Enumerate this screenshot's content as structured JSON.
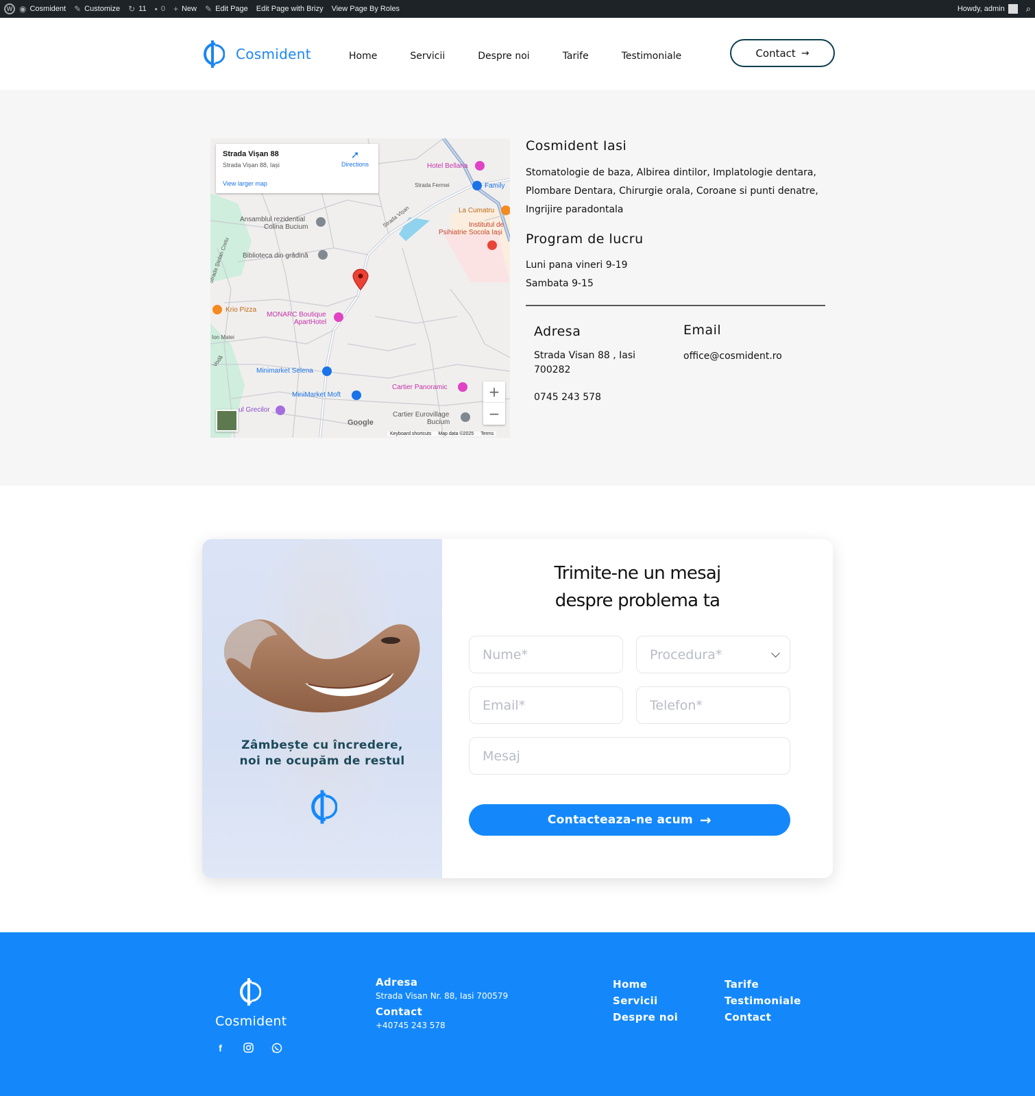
{
  "admin_bar": {
    "site": "Cosmident",
    "customize": "Customize",
    "updates": "11",
    "comments": "0",
    "new": "New",
    "edit_page": "Edit Page",
    "edit_brizy": "Edit Page with Brizy",
    "view_roles": "View Page By Roles",
    "howdy": "Howdy, admin"
  },
  "header": {
    "logo_text": "Cosmident",
    "nav": [
      "Home",
      "Servicii",
      "Despre noi",
      "Tarife",
      "Testimoniale"
    ],
    "contact_label": "Contact",
    "accent": "#1a86f2"
  },
  "map": {
    "place_title": "Strada Vișan 88",
    "place_address": "Strada Vișan 88, Iași",
    "directions": "Directions",
    "larger_map": "View larger map",
    "labels": {
      "hotel_bellaria": "Hotel Bellaria",
      "family": "Family",
      "strada_fermei": "Strada Fermei",
      "la_cumatru": "La Cumatru",
      "institutul_1": "Institutul de",
      "institutul_2": "Psihiatrie Socola Iași",
      "ansamblul_1": "Ansamblul rezidential",
      "ansamblul_2": "Colina Bucium",
      "strada_visan": "Strada Vișan",
      "biblioteca": "Biblioteca din grădină",
      "stefan_cretu": "Strada Ștefan Cretu",
      "krio_pizza": "Krio Pizza",
      "monarc_1": "MONARC Boutique",
      "monarc_2": "ApartHotel",
      "ion_matei": "Ion Matei",
      "vodă": "Vodă",
      "minimarket_selena": "Minimarket Selena",
      "cartier_panoramic": "Cartier Panoramic",
      "minimarket_moft": "MiniMarket Moft",
      "grecilor": "ul Grecilor",
      "eurovillage_1": "Cartier Eurovillage",
      "eurovillage_2": "Bucium"
    },
    "google": "Google",
    "keyboard": "Keyboard shortcuts",
    "map_data": "Map data ©2025",
    "terms": "Terms"
  },
  "info": {
    "title": "Cosmident Iasi",
    "services": "Stomatologie de baza, Albirea dintilor, Implatologie dentara, Plombare Dentara, Chirurgie orala, Coroane si punti denatre, Ingrijire paradontala",
    "program_title": "Program de lucru",
    "hours": [
      "Luni pana vineri 9-19",
      "Sambata 9-15"
    ],
    "address_title": "Adresa",
    "address": "Strada Visan 88 , Iasi 700282",
    "phone": "0745 243 578",
    "email_title": "Email",
    "email": "office@cosmident.ro"
  },
  "form": {
    "tagline_1": "Zâmbește cu încredere,",
    "tagline_2": "noi ne ocupăm de restul",
    "title_1": "Trimite-ne un mesaj",
    "title_2": "despre problema ta",
    "name_placeholder": "Nume*",
    "procedure_placeholder": "Procedura*",
    "email_placeholder": "Email*",
    "phone_placeholder": "Telefon*",
    "message_placeholder": "Mesaj",
    "submit": "Contacteaza-ne acum",
    "button_color": "#1488fb"
  },
  "footer": {
    "logo_text": "Cosmident",
    "address_title": "Adresa",
    "address": "Strada Visan Nr. 88, Iasi 700579",
    "contact_title": "Contact",
    "phone": "+40745 243 578",
    "links_col1": [
      "Home",
      "Servicii",
      "Despre noi"
    ],
    "links_col2": [
      "Tarife",
      "Testimoniale",
      "Contact"
    ],
    "bg": "#1488fb"
  }
}
